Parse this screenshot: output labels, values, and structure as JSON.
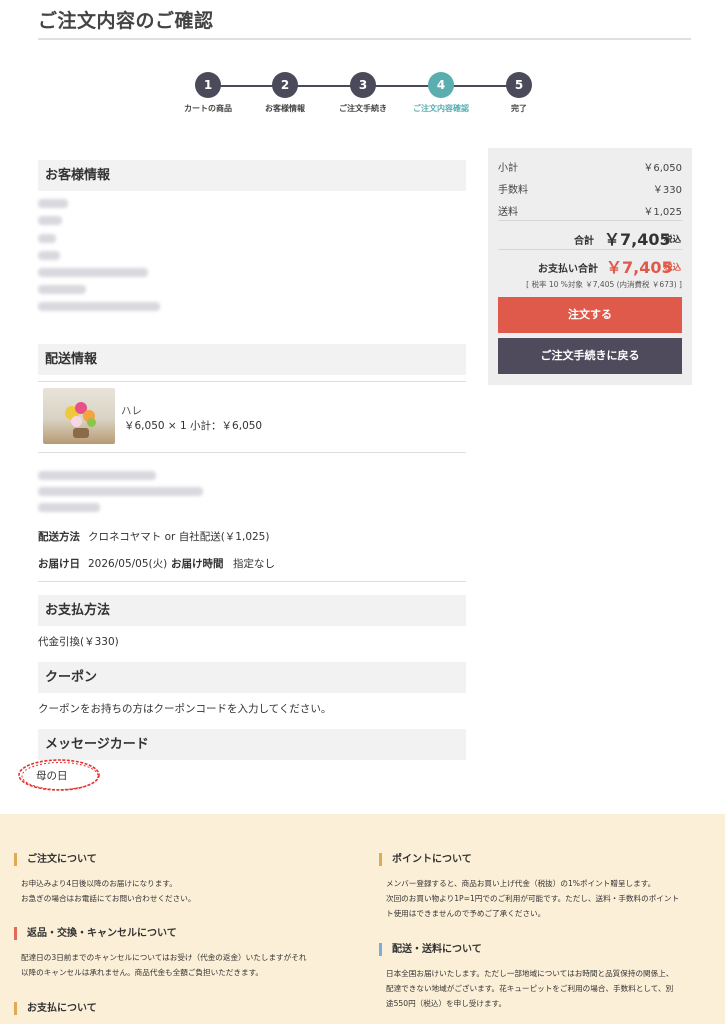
{
  "page_title": "ご注文内容のご確認",
  "steps": [
    {
      "num": "1",
      "label": "カートの商品"
    },
    {
      "num": "2",
      "label": "お客様情報"
    },
    {
      "num": "3",
      "label": "ご注文手続き"
    },
    {
      "num": "4",
      "label": "ご注文内容確認"
    },
    {
      "num": "5",
      "label": "完了"
    }
  ],
  "sections": {
    "customer": "お客様情報",
    "delivery": "配送情報",
    "payment": "お支払方法",
    "coupon": "クーポン",
    "message": "メッセージカード"
  },
  "product": {
    "name": "ハレ",
    "price_line": "￥6,050 × 1  小計：￥6,050"
  },
  "shipping": {
    "method_label": "配送方法",
    "method_value": "クロネコヤマト or 自社配送(￥1,025)",
    "date_label": "お届け日",
    "date_value": "2026/05/05(火)",
    "time_label": "お届け時間",
    "time_value": "指定なし"
  },
  "payment_value": "代金引換(￥330)",
  "coupon_text": "クーポンをお持ちの方はクーポンコードを入力してください。",
  "message_value": "母の日",
  "summary": {
    "subtotal_label": "小計",
    "subtotal_value": "￥6,050",
    "fee_label": "手数料",
    "fee_value": "￥330",
    "shipping_label": "送料",
    "shipping_value": "￥1,025",
    "total_label": "合計",
    "total_value": "￥7,405",
    "total_tax": "税込",
    "pay_total_label": "お支払い合計",
    "pay_total_value": "￥7,405",
    "pay_total_tax": "税込",
    "tax_note": "[ 税率 10 %対象  ￥7,405 (内消費税 ￥673) ]",
    "order_button": "注文する",
    "back_button": "ご注文手続きに戻る"
  },
  "footer": {
    "order_head": "ご注文について",
    "order_body": [
      "お申込みより4日後以降のお届けになります。",
      "お急ぎの場合はお電話にてお問い合わせください。"
    ],
    "return_head": "返品・交換・キャンセルについて",
    "return_body": [
      "配達日の3日前までのキャンセルについてはお受け（代金の返金）いたしますがそれ",
      "以降のキャンセルは承れません。商品代金も全額ご負担いただきます。"
    ],
    "payment_head": "お支払について",
    "point_head": "ポイントについて",
    "point_body": [
      "メンバー登録すると、商品お買い上げ代金（税抜）の1%ポイント贈呈します。",
      "次回のお買い物より1P=1円でのご利用が可能です。ただし、送料・手数料のポイント",
      "ト使用はできませんので予めご了承ください。"
    ],
    "ship_head": "配送・送料について",
    "ship_body": [
      "日本全国お届けいたします。ただし一部地域についてはお時間と品質保持の関係上、",
      "配達できない地域がございます。花キューピットをご利用の場合、手数料として、別",
      "途550円（税込）を申し受けます。"
    ]
  },
  "colors": {
    "accent_teal": "#5aaeb0",
    "step_dark": "#4a4a5a",
    "order_button": "#e05a4b",
    "back_button": "#4f4a5c",
    "price_red": "#e05a4b",
    "footer_bg": "#fcefd7"
  }
}
